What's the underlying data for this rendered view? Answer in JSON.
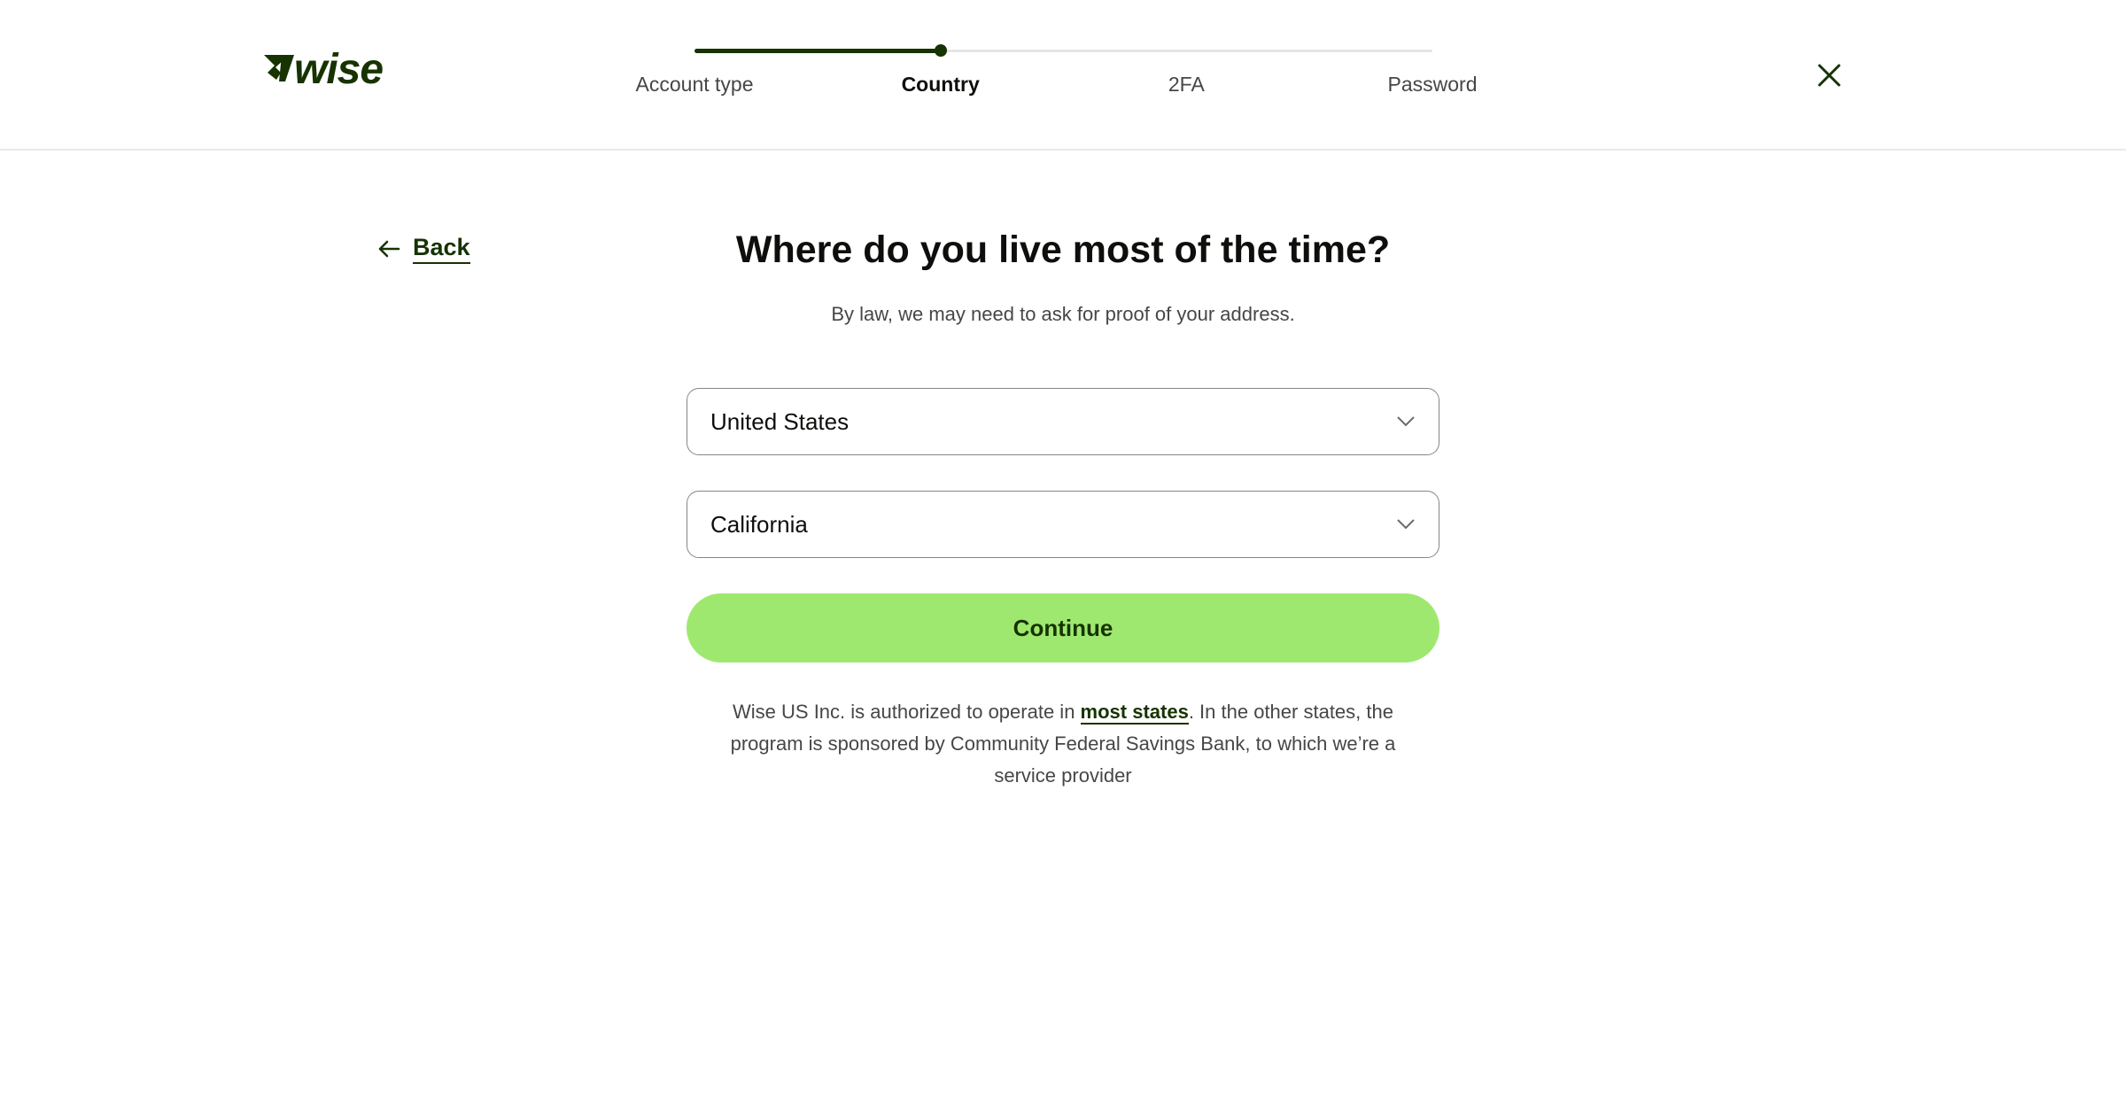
{
  "brand": {
    "name": "Wise",
    "color": "#163300",
    "accent": "#9fe870"
  },
  "stepper": {
    "current_index": 1,
    "progress_fraction": 0.333,
    "steps": [
      {
        "label": "Account type",
        "state": "completed"
      },
      {
        "label": "Country",
        "state": "active"
      },
      {
        "label": "2FA",
        "state": "upcoming"
      },
      {
        "label": "Password",
        "state": "upcoming"
      }
    ]
  },
  "header": {
    "close_icon": "close-icon"
  },
  "back": {
    "label": "Back",
    "icon": "arrow-left-icon"
  },
  "main": {
    "title": "Where do you live most of the time?",
    "subtitle": "By law, we may need to ask for proof of your address.",
    "country_select": {
      "value": "United States",
      "icon": "chevron-down-icon"
    },
    "state_select": {
      "value": "California",
      "icon": "chevron-down-icon"
    },
    "continue_label": "Continue",
    "footer": {
      "text_before": "Wise US Inc. is authorized to operate in ",
      "link_label": "most states",
      "text_after": ". In the other states, the program is sponsored by Community Federal Savings Bank, to which we’re a service provider"
    }
  }
}
